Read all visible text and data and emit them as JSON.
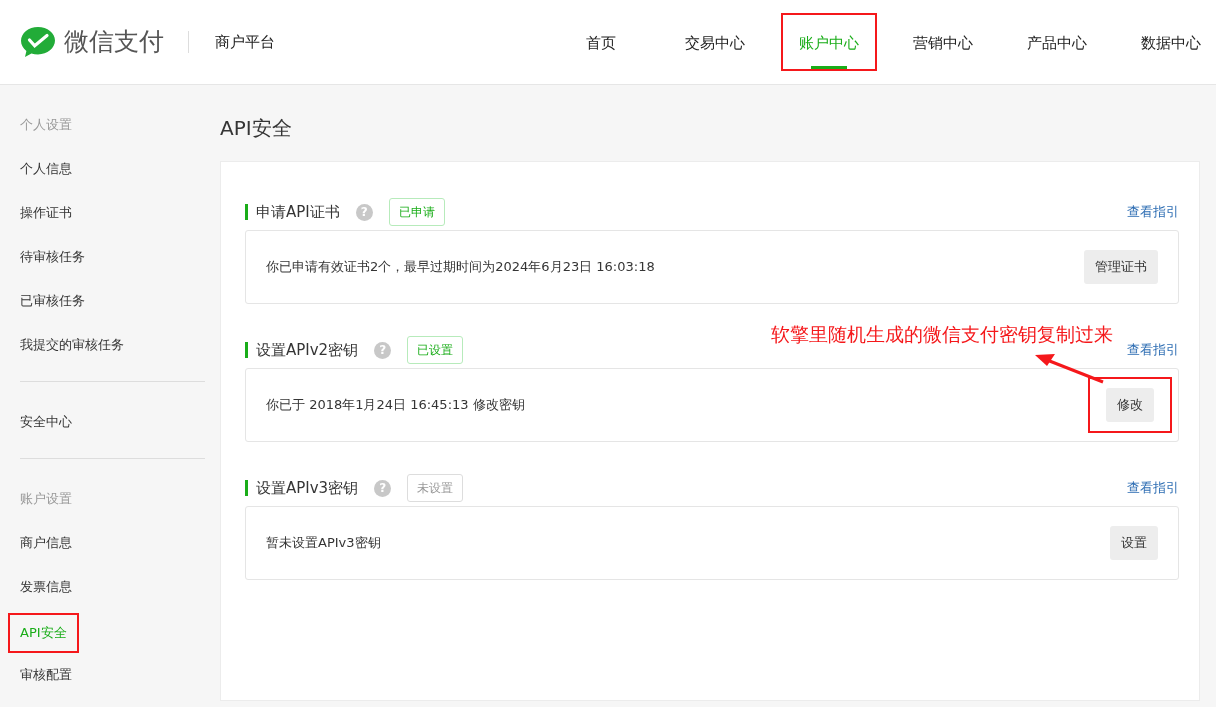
{
  "header": {
    "brand": "微信支付",
    "platform": "商户平台",
    "nav": [
      {
        "label": "首页",
        "selected": false,
        "highlighted": false
      },
      {
        "label": "交易中心",
        "selected": false,
        "highlighted": false
      },
      {
        "label": "账户中心",
        "selected": true,
        "highlighted": true
      },
      {
        "label": "营销中心",
        "selected": false,
        "highlighted": false
      },
      {
        "label": "产品中心",
        "selected": false,
        "highlighted": false
      },
      {
        "label": "数据中心",
        "selected": false,
        "highlighted": false
      }
    ]
  },
  "sidebar": {
    "groups": [
      {
        "title": "个人设置",
        "items": [
          {
            "label": "个人信息",
            "selected": false,
            "highlighted": false
          },
          {
            "label": "操作证书",
            "selected": false,
            "highlighted": false
          },
          {
            "label": "待审核任务",
            "selected": false,
            "highlighted": false
          },
          {
            "label": "已审核任务",
            "selected": false,
            "highlighted": false
          },
          {
            "label": "我提交的审核任务",
            "selected": false,
            "highlighted": false
          }
        ]
      },
      {
        "items": [
          {
            "label": "安全中心",
            "selected": false,
            "highlighted": false
          }
        ]
      },
      {
        "title": "账户设置",
        "items": [
          {
            "label": "商户信息",
            "selected": false,
            "highlighted": false
          },
          {
            "label": "发票信息",
            "selected": false,
            "highlighted": false
          },
          {
            "label": "API安全",
            "selected": true,
            "highlighted": true
          },
          {
            "label": "审核配置",
            "selected": false,
            "highlighted": false
          }
        ]
      }
    ]
  },
  "page_title": "API安全",
  "sections": [
    {
      "title": "申请API证书",
      "help": "?",
      "status": "已申请",
      "status_done": true,
      "link": "查看指引",
      "text": "你已申请有效证书2个，最早过期时间为2024年6月23日 16:03:18",
      "button": "管理证书",
      "highlighted": false
    },
    {
      "title": "设置APIv2密钥",
      "help": "?",
      "status": "已设置",
      "status_done": true,
      "link": "查看指引",
      "text": "你已于 2018年1月24日 16:45:13 修改密钥",
      "button": "修改",
      "highlighted": true,
      "annotation": "软擎里随机生成的微信支付密钥复制过来"
    },
    {
      "title": "设置APIv3密钥",
      "help": "?",
      "status": "未设置",
      "status_done": false,
      "link": "查看指引",
      "text": "暂未设置APIv3密钥",
      "button": "设置",
      "highlighted": false
    }
  ]
}
